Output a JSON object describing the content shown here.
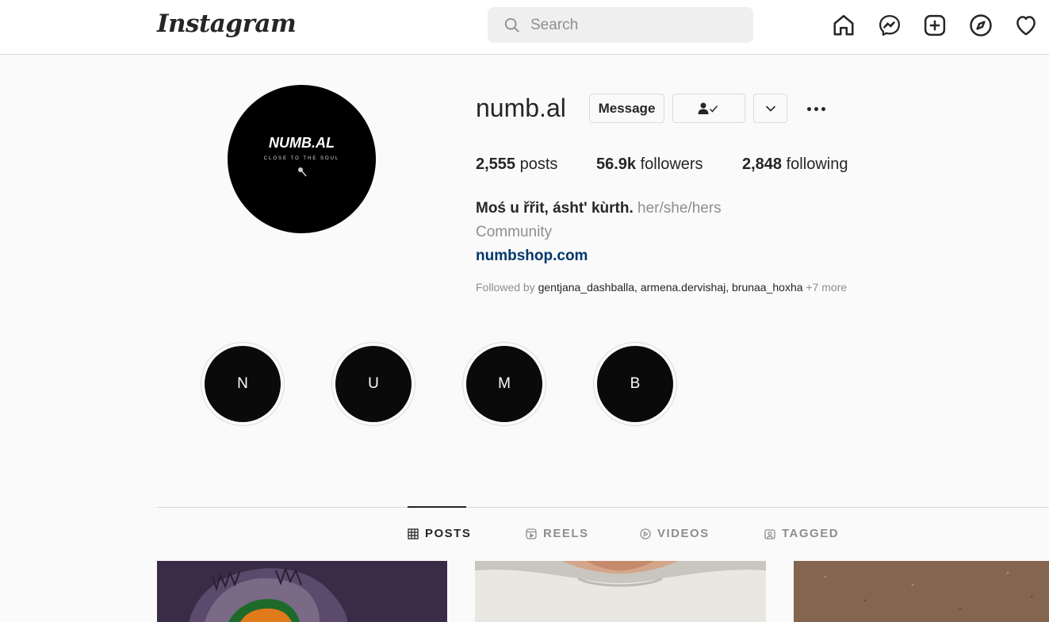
{
  "header": {
    "logo": "Instagram",
    "search_placeholder": "Search",
    "nav": [
      "home-icon",
      "messenger-icon",
      "new-post-icon",
      "explore-icon",
      "activity-icon"
    ]
  },
  "profile": {
    "username": "numb.al",
    "avatar_brand": "NUMB.AL",
    "avatar_tagline": "CLOSE TO THE SOUL",
    "message_label": "Message",
    "stats": {
      "posts_count": "2,555",
      "posts_label": "posts",
      "followers_count": "56.9k",
      "followers_label": "followers",
      "following_count": "2,848",
      "following_label": "following"
    },
    "bio": {
      "name": "Moś u řřit, ásht' kùrth.",
      "pronouns": "her/she/hers",
      "category": "Community",
      "link": "numbshop.com"
    },
    "followed_by": {
      "prefix": "Followed by",
      "users": [
        "gentjana_dashballa",
        "armena.dervishaj",
        "brunaa_hoxha"
      ],
      "more": "+7 more"
    }
  },
  "highlights": [
    "N",
    "U",
    "M",
    "B"
  ],
  "tabs": [
    {
      "label": "POSTS",
      "icon": "grid-icon",
      "active": true
    },
    {
      "label": "REELS",
      "icon": "reels-icon",
      "active": false
    },
    {
      "label": "VIDEOS",
      "icon": "video-icon",
      "active": false
    },
    {
      "label": "TAGGED",
      "icon": "tagged-icon",
      "active": false
    }
  ],
  "colors": {
    "link": "#00376b",
    "muted": "#8e8e8e",
    "text": "#262626"
  }
}
